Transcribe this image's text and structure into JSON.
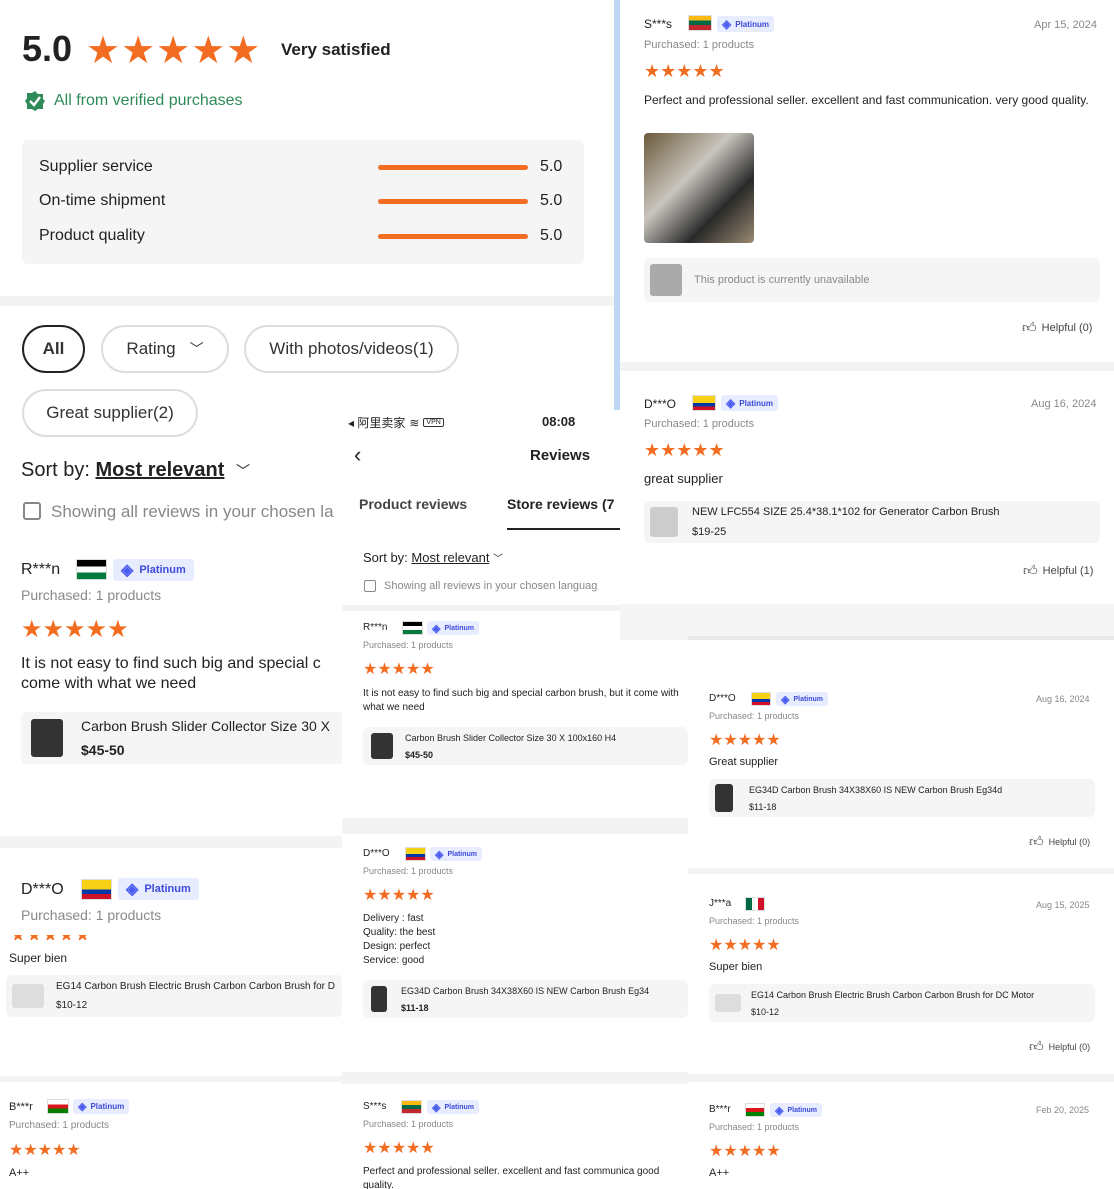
{
  "summary": {
    "score": "5.0",
    "label": "Very satisfied",
    "verified": "All from verified purchases",
    "metrics": [
      {
        "name": "Supplier service",
        "value": "5.0",
        "fraction": 1.0
      },
      {
        "name": "On-time shipment",
        "value": "5.0",
        "fraction": 1.0
      },
      {
        "name": "Product quality",
        "value": "5.0",
        "fraction": 1.0
      }
    ]
  },
  "filters": {
    "all": "All",
    "rating": "Rating",
    "photos": "With photos/videos(1)",
    "great": "Great supplier(2)"
  },
  "sort": {
    "label": "Sort by:",
    "value": "Most relevant",
    "showing": "Showing all reviews in your chosen la"
  },
  "badge": "Platinum",
  "purchased": "Purchased: 1 products",
  "helpful0": "Helpful (0)",
  "helpful1": "Helpful (1)",
  "left": {
    "r1": {
      "name": "R***n",
      "text": "It is not easy to find such big and special c come with what we need",
      "product": "Carbon Brush Slider Collector Size 30 X",
      "price": "$45-50"
    },
    "r2": {
      "name": "D***O",
      "text": "Super bien",
      "product": "EG14 Carbon Brush  Electric Brush Carbon  Carbon Brush for D",
      "price": "$10-12"
    },
    "r3": {
      "name": "B***r",
      "text": "A++"
    }
  },
  "phone": {
    "status_left": "◂ 阿里卖家",
    "vpn": "VPN",
    "time": "08:08",
    "title": "Reviews",
    "tab1": "Product reviews",
    "tab2": "Store reviews (7",
    "sort_label": "Sort by:",
    "sort_value": "Most relevant",
    "showing": "Showing all reviews in your chosen languag",
    "r1": {
      "name": "R***n",
      "text": "It is not easy to find such big and special carbon brush, but it come with what we need",
      "product": "Carbon Brush Slider Collector Size 30 X 100x160 H4",
      "price": "$45-50"
    },
    "r2": {
      "name": "D***O",
      "lines": [
        "Delivery : fast",
        "Quality: the best",
        "Design: perfect",
        "Service: good"
      ],
      "product": "EG34D Carbon Brush  34X38X60 IS NEW  Carbon Brush Eg34",
      "price": "$11-18"
    },
    "r3": {
      "name": "S***s",
      "text": "Perfect and professional seller. excellent and fast communica good quality."
    }
  },
  "right": {
    "r1": {
      "name": "S***s",
      "date": "Apr 15, 2024",
      "text": "Perfect and professional seller. excellent and fast communication. very good quality.",
      "unavailable": "This product is currently unavailable"
    },
    "r2": {
      "name": "D***O",
      "date": "Aug 16, 2024",
      "text": "great supplier",
      "product": "NEW LFC554 SIZE 25.4*38.1*102 for Generator Carbon Brush",
      "price": "$19-25"
    },
    "r3": {
      "name": "D***O",
      "date": "Aug 16, 2024",
      "text": "Great supplier",
      "product": "EG34D Carbon Brush  34X38X60 IS NEW  Carbon Brush Eg34d",
      "price": "$11-18"
    },
    "r4": {
      "name": "J***a",
      "date": "Aug 15, 2025",
      "text": "Super bien",
      "product": "EG14 Carbon Brush  Electric Brush Carbon  Carbon Brush for DC Motor",
      "price": "$10-12"
    },
    "r5": {
      "name": "B***r",
      "date": "Feb 20, 2025",
      "text": "A++"
    }
  },
  "stars": "★★★★★",
  "colors": {
    "accent": "#f26d21",
    "verified": "#2e8b57",
    "platinum": "#3b4bd8"
  }
}
